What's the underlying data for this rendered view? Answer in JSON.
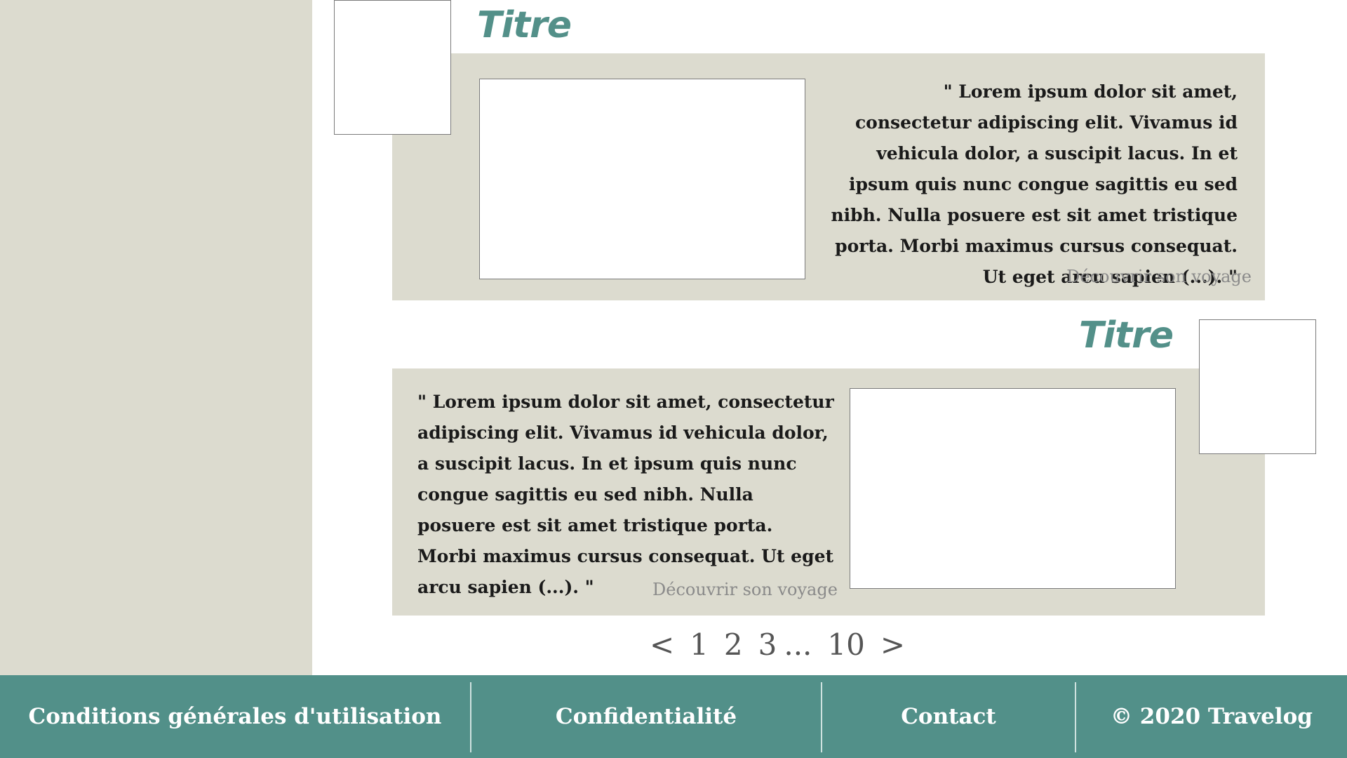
{
  "articles": [
    {
      "title": "Titre",
      "excerpt": "\" Lorem ipsum dolor sit amet, consectetur adipiscing elit. Vivamus id vehicula dolor, a suscipit lacus. In et ipsum quis nunc congue sagittis eu sed nibh. Nulla posuere est sit amet tristique porta. Morbi maximus cursus consequat. Ut eget arcu sapien (...). \"",
      "link_label": "Découvrir son voyage"
    },
    {
      "title": "Titre",
      "excerpt": "\" Lorem ipsum dolor sit amet, consectetur adipiscing elit. Vivamus id vehicula dolor, a suscipit lacus. In et ipsum quis nunc congue sagittis eu sed nibh. Nulla posuere est sit amet tristique porta. Morbi maximus cursus consequat. Ut eget arcu sapien (...). \"",
      "link_label": "Découvrir son voyage"
    }
  ],
  "pagination": {
    "prev": "<",
    "pages": [
      "1",
      "2",
      "3"
    ],
    "ellipsis": "...",
    "last": "10",
    "next": ">"
  },
  "footer": {
    "terms": "Conditions générales d'utilisation",
    "privacy": "Confidentialité",
    "contact": "Contact",
    "copyright": "©  2020 Travelog"
  },
  "colors": {
    "accent": "#539089",
    "panel": "#dcdbcf",
    "footer": "#529089"
  }
}
